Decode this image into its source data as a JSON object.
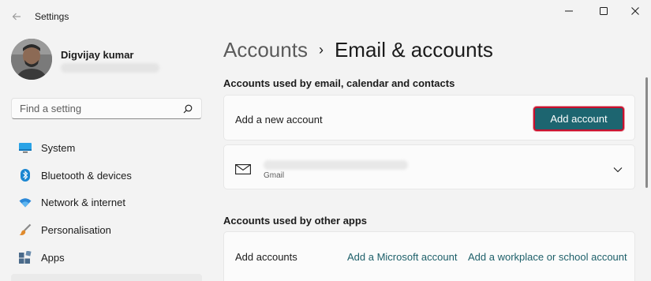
{
  "window": {
    "title": "Settings"
  },
  "user": {
    "name": "Digvijay kumar"
  },
  "search": {
    "placeholder": "Find a setting"
  },
  "sidebar": {
    "items": [
      {
        "label": "System",
        "icon": "monitor-icon"
      },
      {
        "label": "Bluetooth & devices",
        "icon": "bluetooth-icon"
      },
      {
        "label": "Network & internet",
        "icon": "wifi-icon"
      },
      {
        "label": "Personalisation",
        "icon": "brush-icon"
      },
      {
        "label": "Apps",
        "icon": "apps-icon"
      }
    ]
  },
  "breadcrumb": {
    "parent": "Accounts",
    "separator": "›",
    "current": "Email & accounts"
  },
  "sections": {
    "email": {
      "title": "Accounts used by email, calendar and contacts",
      "add_row_label": "Add a new account",
      "add_button": "Add account",
      "account_type": "Gmail"
    },
    "other": {
      "title": "Accounts used by other apps",
      "row_label": "Add accounts",
      "microsoft_link": "Add a Microsoft account",
      "work_link": "Add a workplace or school account"
    }
  },
  "colors": {
    "accent": "#1d6570",
    "highlight_border": "#c8102e",
    "background": "#f3f3f3",
    "card": "#fbfbfb"
  }
}
